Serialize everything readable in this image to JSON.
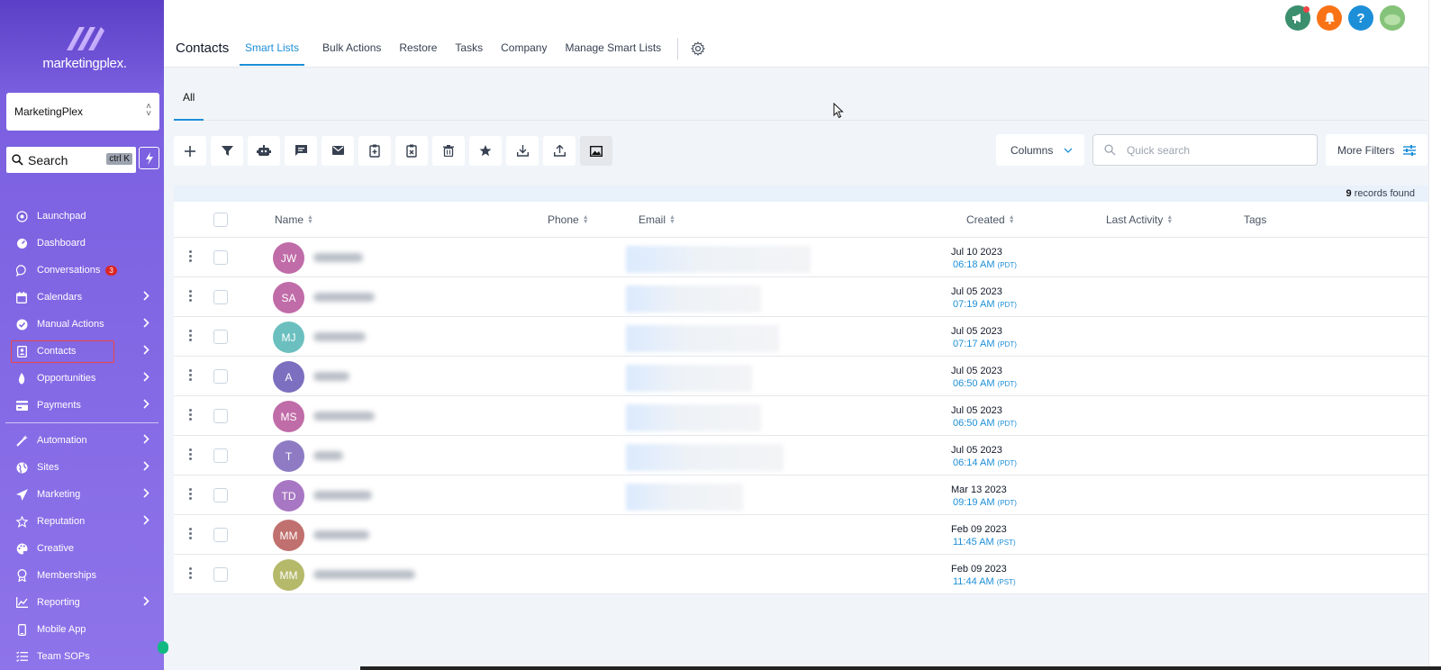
{
  "sidebar": {
    "logo_text": "marketingplex.",
    "account": "MarketingPlex",
    "search_label": "Search",
    "search_shortcut": "ctrl K",
    "items": [
      {
        "label": "Launchpad",
        "icon": "rocket-icon",
        "arrow": false
      },
      {
        "label": "Dashboard",
        "icon": "dashboard-icon",
        "arrow": false
      },
      {
        "label": "Conversations",
        "icon": "chat-icon",
        "arrow": false,
        "badge": "3"
      },
      {
        "label": "Calendars",
        "icon": "calendar-icon",
        "arrow": true
      },
      {
        "label": "Manual Actions",
        "icon": "check-circle-icon",
        "arrow": true
      },
      {
        "label": "Contacts",
        "icon": "contact-book-icon",
        "arrow": true,
        "active": true
      },
      {
        "label": "Opportunities",
        "icon": "flame-icon",
        "arrow": true
      },
      {
        "label": "Payments",
        "icon": "card-icon",
        "arrow": true
      }
    ],
    "items2": [
      {
        "label": "Automation",
        "icon": "wand-icon",
        "arrow": true
      },
      {
        "label": "Sites",
        "icon": "globe-icon",
        "arrow": true
      },
      {
        "label": "Marketing",
        "icon": "send-icon",
        "arrow": true
      },
      {
        "label": "Reputation",
        "icon": "star-icon",
        "arrow": true
      },
      {
        "label": "Creative",
        "icon": "palette-icon",
        "arrow": false
      },
      {
        "label": "Memberships",
        "icon": "award-icon",
        "arrow": false
      },
      {
        "label": "Reporting",
        "icon": "chart-icon",
        "arrow": true
      },
      {
        "label": "Mobile App",
        "icon": "phone-icon",
        "arrow": false
      },
      {
        "label": "Team SOPs",
        "icon": "list-icon",
        "arrow": false
      }
    ]
  },
  "topbar": {
    "title": "Contacts",
    "tabs": [
      "Smart Lists",
      "Bulk Actions",
      "Restore",
      "Tasks",
      "Company",
      "Manage Smart Lists"
    ],
    "icons": [
      {
        "name": "megaphone-icon",
        "color": "#3b8f6e",
        "glyph": "📣"
      },
      {
        "name": "bell-icon",
        "color": "#f97316",
        "glyph": "🔔"
      },
      {
        "name": "help-icon",
        "color": "#1d8fd8",
        "glyph": "?"
      },
      {
        "name": "avatar-icon",
        "color": "#86c37a",
        "glyph": ""
      }
    ]
  },
  "subtab": "All",
  "toolbar": {
    "columns_label": "Columns",
    "search_placeholder": "Quick search",
    "more_filters_label": "More Filters"
  },
  "records": {
    "count": "9",
    "suffix": " records found"
  },
  "table": {
    "headers": [
      "Name",
      "Phone",
      "Email",
      "Created",
      "Last Activity",
      "Tags"
    ],
    "rows": [
      {
        "initials": "JW",
        "color": "#c06ca8",
        "date": "Jul 10 2023",
        "time": "06:18 AM",
        "tz": "(PDT)",
        "email_blur": true
      },
      {
        "initials": "SA",
        "color": "#c06ca8",
        "date": "Jul 05 2023",
        "time": "07:19 AM",
        "tz": "(PDT)",
        "email_blur": true
      },
      {
        "initials": "MJ",
        "color": "#6bbfbf",
        "date": "Jul 05 2023",
        "time": "07:17 AM",
        "tz": "(PDT)",
        "email_blur": true
      },
      {
        "initials": "A",
        "color": "#7c6fbf",
        "date": "Jul 05 2023",
        "time": "06:50 AM",
        "tz": "(PDT)",
        "email_blur": true
      },
      {
        "initials": "MS",
        "color": "#c06ca8",
        "date": "Jul 05 2023",
        "time": "06:50 AM",
        "tz": "(PDT)",
        "email_blur": true
      },
      {
        "initials": "T",
        "color": "#8e7bc4",
        "date": "Jul 05 2023",
        "time": "06:14 AM",
        "tz": "(PDT)",
        "email_blur": true
      },
      {
        "initials": "TD",
        "color": "#a877c4",
        "date": "Mar 13 2023",
        "time": "09:19 AM",
        "tz": "(PDT)",
        "email_blur": true
      },
      {
        "initials": "MM",
        "color": "#c0706e",
        "date": "Feb 09 2023",
        "time": "11:45 AM",
        "tz": "(PST)",
        "email_blur": false
      },
      {
        "initials": "MM",
        "color": "#b5b96a",
        "date": "Feb 09 2023",
        "time": "11:44 AM",
        "tz": "(PST)",
        "email_blur": false
      }
    ]
  }
}
